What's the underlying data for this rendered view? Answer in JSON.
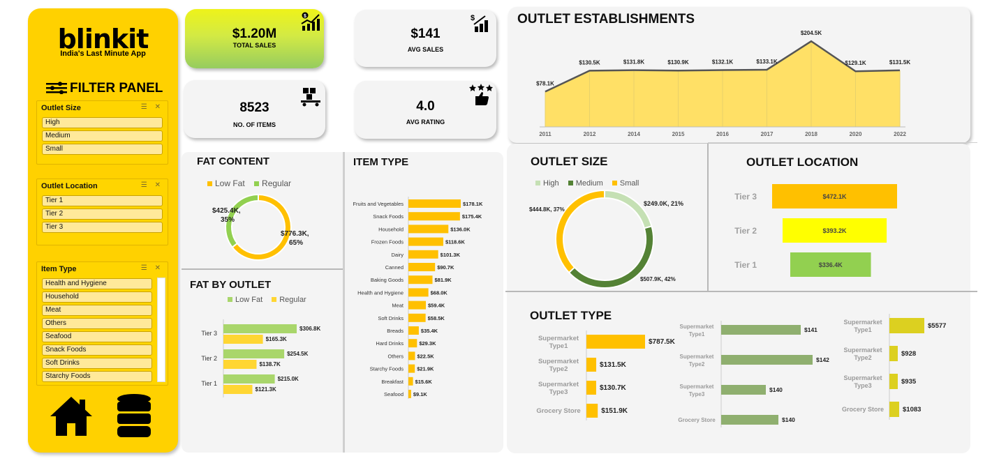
{
  "brand": {
    "logo": "blinkit",
    "tagline": "India's Last Minute App",
    "filter_title": "FILTER PANEL"
  },
  "slicers": [
    {
      "title": "Outlet Size",
      "items": [
        "High",
        "Medium",
        "Small"
      ]
    },
    {
      "title": "Outlet Location",
      "items": [
        "Tier 1",
        "Tier 2",
        "Tier 3"
      ]
    },
    {
      "title": "Item Type",
      "items": [
        "Health and Hygiene",
        "Household",
        "Meat",
        "Others",
        "Seafood",
        "Snack Foods",
        "Soft Drinks",
        "Starchy Foods"
      ]
    }
  ],
  "kpis": {
    "total_sales": {
      "value": "$1.20M",
      "label": "TOTAL SALES"
    },
    "avg_sales": {
      "value": "$141",
      "label": "AVG SALES"
    },
    "items": {
      "value": "8523",
      "label": "NO. OF ITEMS"
    },
    "avg_rating": {
      "value": "4.0",
      "label": "AVG RATING"
    }
  },
  "sections": {
    "outlet_establishments": "OUTLET ESTABLISHMENTS",
    "fat_content": "FAT CONTENT",
    "item_type": "ITEM TYPE",
    "fat_by_outlet": "FAT BY OUTLET",
    "outlet_size": "OUTLET SIZE",
    "outlet_location": "OUTLET LOCATION",
    "outlet_type": "OUTLET TYPE"
  },
  "colors": {
    "sidebar": "#ffd100",
    "yellow": "#ffc000",
    "light_yellow": "#ffe066",
    "green": "#92d050",
    "dark_green": "#548235",
    "pale_green": "#c5e0b4",
    "olive": "#8faf6f",
    "mustard": "#dcd020",
    "bright_yellow": "#ffff00"
  },
  "chart_data": [
    {
      "id": "establishments",
      "type": "area",
      "x": [
        "2011",
        "2012",
        "2014",
        "2015",
        "2016",
        "2017",
        "2018",
        "2020",
        "2022"
      ],
      "values": [
        78.1,
        130.5,
        131.8,
        130.9,
        132.1,
        133.1,
        204.5,
        129.1,
        131.5
      ],
      "labels": [
        "$78.1K",
        "$130.5K",
        "$131.8K",
        "$130.9K",
        "$132.1K",
        "$133.1K",
        "$204.5K",
        "$129.1K",
        "$131.5K"
      ],
      "ylim": [
        0,
        210
      ]
    },
    {
      "id": "fat_content",
      "type": "pie",
      "categories": [
        "Low Fat",
        "Regular"
      ],
      "values": [
        776.3,
        425.4
      ],
      "labels": [
        "$776.3K,",
        "65%",
        "$425.4K,",
        "35%"
      ]
    },
    {
      "id": "item_type",
      "type": "bar",
      "categories": [
        "Fruits and Vegetables",
        "Snack Foods",
        "Household",
        "Frozen Foods",
        "Dairy",
        "Canned",
        "Baking Goods",
        "Health and Hygiene",
        "Meat",
        "Soft Drinks",
        "Breads",
        "Hard Drinks",
        "Others",
        "Starchy Foods",
        "Breakfast",
        "Seafood"
      ],
      "values": [
        178.1,
        175.4,
        136.0,
        118.6,
        101.3,
        90.7,
        81.9,
        68.0,
        59.4,
        58.5,
        35.4,
        29.3,
        22.5,
        21.9,
        15.6,
        9.1
      ],
      "labels": [
        "$178.1K",
        "$175.4K",
        "$136.0K",
        "$118.6K",
        "$101.3K",
        "$90.7K",
        "$81.9K",
        "$68.0K",
        "$59.4K",
        "$58.5K",
        "$35.4K",
        "$29.3K",
        "$22.5K",
        "$21.9K",
        "$15.6K",
        "$9.1K"
      ]
    },
    {
      "id": "fat_by_outlet",
      "type": "bar",
      "categories": [
        "Tier 3",
        "Tier 2",
        "Tier 1"
      ],
      "series": [
        {
          "name": "Low Fat",
          "values": [
            306.8,
            254.5,
            215.0
          ],
          "labels": [
            "$306.8K",
            "$254.5K",
            "$215.0K"
          ]
        },
        {
          "name": "Regular",
          "values": [
            165.3,
            138.7,
            121.3
          ],
          "labels": [
            "$165.3K",
            "$138.7K",
            "$121.3K"
          ]
        }
      ]
    },
    {
      "id": "outlet_size",
      "type": "pie",
      "categories": [
        "High",
        "Medium",
        "Small"
      ],
      "values": [
        249.0,
        507.9,
        444.8
      ],
      "labels": [
        "$249.0K, 21%",
        "$507.9K, 42%",
        "$444.8K, 37%"
      ]
    },
    {
      "id": "outlet_location",
      "type": "bar",
      "categories": [
        "Tier 3",
        "Tier 2",
        "Tier 1"
      ],
      "values": [
        472.1,
        393.2,
        336.4
      ],
      "labels": [
        "$472.1K",
        "$393.2K",
        "$336.4K"
      ]
    },
    {
      "id": "outlet_type_sales",
      "type": "bar",
      "categories": [
        "Supermarket Type1",
        "Supermarket Type2",
        "Supermarket Type3",
        "Grocery Store"
      ],
      "values": [
        787.5,
        131.5,
        130.7,
        151.9
      ],
      "labels": [
        "$787.5K",
        "$131.5K",
        "$130.7K",
        "$151.9K"
      ]
    },
    {
      "id": "outlet_type_avg",
      "type": "bar",
      "categories": [
        "Supermarket Type1",
        "Supermarket Type2",
        "Supermarket Type3",
        "Grocery Store"
      ],
      "values": [
        141,
        142,
        140,
        140
      ],
      "labels": [
        "$141",
        "$142",
        "$140",
        "$140"
      ]
    },
    {
      "id": "outlet_type_items",
      "type": "bar",
      "categories": [
        "Supermarket Type1",
        "Supermarket Type2",
        "Supermarket Type3",
        "Grocery Store"
      ],
      "values": [
        5577,
        928,
        935,
        1083
      ],
      "labels": [
        "$5577",
        "$928",
        "$935",
        "$1083"
      ]
    }
  ]
}
